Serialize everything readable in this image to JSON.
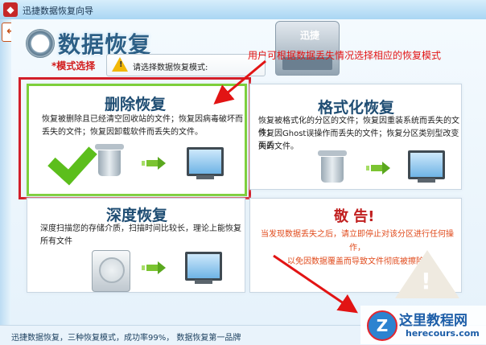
{
  "window": {
    "title": "迅捷数据恢复向导"
  },
  "header": {
    "title": "数据恢复",
    "mode_label": "*模式选择",
    "mode_select_text": "请选择数据恢复模式:",
    "device_label": "迅捷"
  },
  "annotation": "用户可根据数据丢失情况选择相应的恢复模式",
  "cards": {
    "delete": {
      "title": "删除恢复",
      "desc_1": "恢复被删除且已经清空回收站的文件；恢复因病毒破坏而",
      "desc_2": "丢失的文件；恢复因卸载软件而丢失的文件。"
    },
    "format": {
      "title": "格式化恢复",
      "desc_1": "恢复被格式化的分区的文件；恢复因重装系统而丢失的文件；",
      "desc_2": "恢复因Ghost误操作而丢失的文件；恢复分区类别型改变而丢",
      "desc_3": "失的文件。"
    },
    "deep": {
      "title": "深度恢复",
      "desc_1": "深度扫描您的存储介质，扫描时间比较长，理论上能恢复",
      "desc_2": "所有文件"
    },
    "warning": {
      "title": "敬 告!",
      "line_1": "当发现数据丢失之后，请立即停止对该分区进行任何操作，",
      "line_2": "以免因数据覆盖而导致文件彻底被擦除!"
    }
  },
  "footer": {
    "text": "迅捷数据恢复，三种恢复模式，成功率99%，  数据恢复第一品牌"
  },
  "watermark": {
    "logo_letter": "Z",
    "name": "这里教程网",
    "url": "herecours.com"
  },
  "colors": {
    "highlight": "#d21f2a",
    "selected": "#7dcf3b",
    "title_blue": "#1f4d73",
    "warning": "#c12020"
  }
}
